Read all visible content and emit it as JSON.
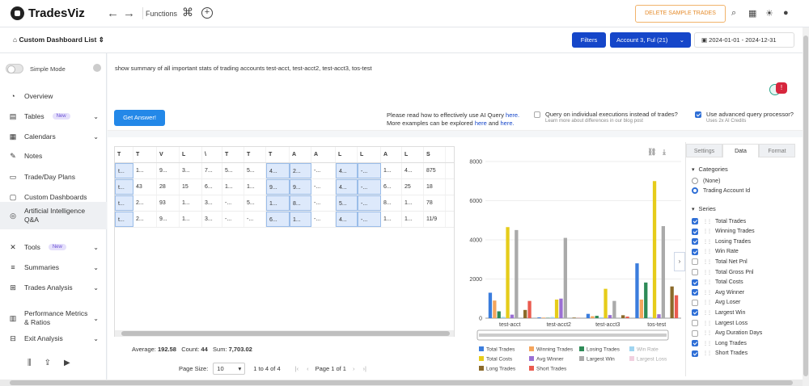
{
  "topbar": {
    "app_name": "TradesViz",
    "functions_label": "Functions",
    "delete_label": "DELETE SAMPLE TRADES"
  },
  "filterbar": {
    "dashboard_label": "Custom Dashboard List",
    "filters_label": "Filters",
    "account_label": "Account 3, Ful (21)",
    "date_range": "2024-01-01 - 2024-12-31"
  },
  "sidebar": {
    "simple_mode": "Simple Mode",
    "items": [
      {
        "label": "Overview",
        "icon": "pie-icon"
      },
      {
        "label": "Tables",
        "icon": "table-icon",
        "badge": "New",
        "chevron": true
      },
      {
        "label": "Calendars",
        "icon": "calendar-icon",
        "chevron": true
      },
      {
        "label": "Notes",
        "icon": "edit-icon"
      },
      {
        "label": "Trade/Day Plans",
        "icon": "clipboard-icon"
      },
      {
        "label": "Custom Dashboards",
        "icon": "dashboard-icon"
      },
      {
        "label": "Artificial Intelligence Q&A",
        "icon": "ai-icon",
        "active": true
      },
      {
        "label": "Tools",
        "icon": "tools-icon",
        "badge": "New",
        "chevron": true
      },
      {
        "label": "Summaries",
        "icon": "summaries-icon",
        "chevron": true
      },
      {
        "label": "Trades Analysis",
        "icon": "analysis-icon",
        "chevron": true
      },
      {
        "label": "Performance Metrics & Ratios",
        "icon": "metrics-icon",
        "chevron": true
      },
      {
        "label": "Exit Analysis",
        "icon": "exit-icon",
        "chevron": true
      }
    ]
  },
  "query": {
    "text": "show summary of all important stats of trading accounts test-acct, test-acct2, test-acct3, tos-test"
  },
  "actions": {
    "get_answer": "Get Answer!",
    "help_line1_a": "Please read how to effectively use AI Query ",
    "help_line1_link": "here.",
    "help_line2_a": "More examples can be explored ",
    "help_line2_link1": "here",
    "help_line2_b": " and ",
    "help_line2_link2": "here.",
    "opt_individual": "Query on individual executions instead of trades?",
    "opt_individual_sub": "Learn more about differences in our blog post",
    "opt_advanced": "Use advanced query processor?",
    "opt_advanced_sub": "Uses 2x AI Credits"
  },
  "grid": {
    "headers": [
      "T",
      "T",
      "V",
      "L",
      "\\",
      "T",
      "T",
      "T",
      "A",
      "A",
      "L",
      "L",
      "A",
      "L",
      "S"
    ],
    "rows": [
      [
        "t...",
        "1...",
        "9...",
        "3...",
        "7...",
        "5...",
        "5...",
        "4...",
        "2...",
        "-...",
        "4...",
        "-...",
        "1...",
        "4...",
        "875"
      ],
      [
        "t...",
        "43",
        "28",
        "15",
        "6...",
        "1...",
        "1...",
        "9...",
        "9...",
        "-...",
        "4...",
        "-...",
        "6...",
        "25",
        "18"
      ],
      [
        "t...",
        "2...",
        "93",
        "1...",
        "3...",
        "-...",
        "5...",
        "1...",
        "8...",
        "-...",
        "5...",
        "-...",
        "8...",
        "1...",
        "78"
      ],
      [
        "t...",
        "2...",
        "9...",
        "1...",
        "3...",
        "-...",
        "-...",
        "6...",
        "1...",
        "-...",
        "4...",
        "-...",
        "1...",
        "1...",
        "11/9"
      ]
    ],
    "average_label": "Average:",
    "average_value": "192.58",
    "count_label": "Count:",
    "count_value": "44",
    "sum_label": "Sum:",
    "sum_value": "7,703.02",
    "page_size_label": "Page Size:",
    "page_size_value": "10",
    "range_text": "1 to 4 of 4",
    "page_text": "Page 1 of 1"
  },
  "panel": {
    "tabs": [
      "Settings",
      "Data",
      "Format"
    ],
    "active_tab": 1,
    "categories_title": "Categories",
    "categories": [
      {
        "label": "(None)",
        "selected": false
      },
      {
        "label": "Trading Account Id",
        "selected": true
      }
    ],
    "series_title": "Series",
    "series": [
      {
        "label": "Total Trades",
        "checked": true
      },
      {
        "label": "Winning Trades",
        "checked": true
      },
      {
        "label": "Losing Trades",
        "checked": true
      },
      {
        "label": "Win Rate",
        "checked": true
      },
      {
        "label": "Total Net Pnl",
        "checked": false
      },
      {
        "label": "Total Gross Pnl",
        "checked": false
      },
      {
        "label": "Total Costs",
        "checked": true
      },
      {
        "label": "Avg Winner",
        "checked": true
      },
      {
        "label": "Avg Loser",
        "checked": false
      },
      {
        "label": "Largest Win",
        "checked": true
      },
      {
        "label": "Largest Loss",
        "checked": false
      },
      {
        "label": "Avg Duration Days",
        "checked": false
      },
      {
        "label": "Long Trades",
        "checked": true
      },
      {
        "label": "Short Trades",
        "checked": true
      }
    ]
  },
  "chart_data": {
    "type": "bar",
    "categories": [
      "test-acct",
      "test-acct2",
      "test-acct3",
      "tos-test"
    ],
    "ylim": [
      0,
      8000
    ],
    "yticks": [
      "0",
      "2000",
      "4000",
      "6000",
      "8000"
    ],
    "legend_position": "bottom",
    "series": [
      {
        "name": "Total Trades",
        "color": "#3b7ddd",
        "values": [
          1300,
          40,
          220,
          2800
        ]
      },
      {
        "name": "Winning Trades",
        "color": "#f5a55c",
        "values": [
          900,
          30,
          100,
          950
        ]
      },
      {
        "name": "Losing Trades",
        "color": "#2e8b57",
        "values": [
          350,
          15,
          120,
          1820
        ]
      },
      {
        "name": "Win Rate",
        "color": "#9fd4f0",
        "values": [
          65,
          60,
          45,
          55
        ]
      },
      {
        "name": "Total Costs",
        "color": "#e6cc1a",
        "values": [
          4650,
          950,
          1500,
          7000
        ]
      },
      {
        "name": "Avg Winner",
        "color": "#9b6fd3",
        "values": [
          180,
          1000,
          160,
          200
        ]
      },
      {
        "name": "Largest Win",
        "color": "#aaaaaa",
        "values": [
          4500,
          4100,
          880,
          4700
        ]
      },
      {
        "name": "Largest Loss",
        "color": "#f1d0df",
        "values": [
          0,
          0,
          0,
          0
        ]
      },
      {
        "name": "Long Trades",
        "color": "#8b6a2a",
        "values": [
          420,
          30,
          150,
          1620
        ]
      },
      {
        "name": "Short Trades",
        "color": "#ea5b4f",
        "values": [
          880,
          10,
          80,
          1170
        ]
      }
    ]
  }
}
